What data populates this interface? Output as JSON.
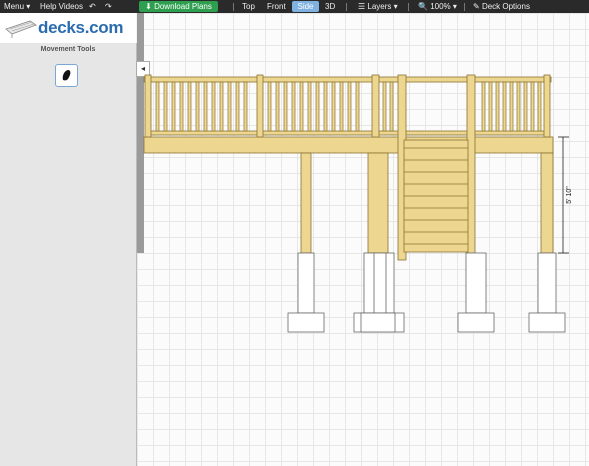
{
  "toolbar": {
    "menu": "Menu",
    "help_videos": "Help Videos",
    "download_plans": "Download Plans",
    "views": {
      "top": "Top",
      "front": "Front",
      "side": "Side",
      "three_d": "3D"
    },
    "layers": "Layers",
    "zoom": "100%",
    "deck_options": "Deck Options"
  },
  "logo": {
    "text": "decks.com"
  },
  "sidebar": {
    "title": "Movement Tools"
  },
  "drawing": {
    "dimension_label": "5' 10\""
  },
  "colors": {
    "wood": "#ecd690",
    "wood_stroke": "#8a7330",
    "download_green": "#2e9e4f",
    "active_tab": "#7fb2e0"
  }
}
